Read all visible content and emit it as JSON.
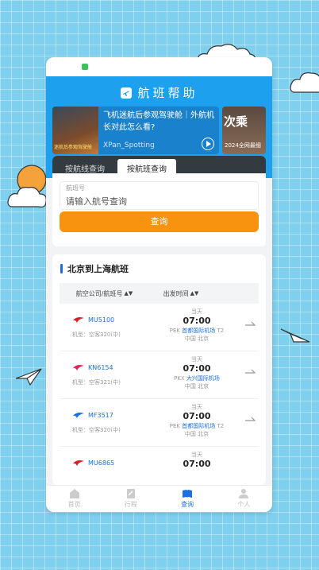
{
  "header": {
    "title": "航班帮助"
  },
  "banner": {
    "headline": "飞机迷航后参观驾驶舱｜外航机长对此怎么看?",
    "thumb_caption": "迷航后参观驾驶舱",
    "source": "XPan_Spotting",
    "side_big": "次乘",
    "side_small": "2024全网最细"
  },
  "search": {
    "tabs": [
      "按航线查询",
      "按航班查询"
    ],
    "field_label": "航班号",
    "field_placeholder": "请输入航号查询",
    "button_label": "查询"
  },
  "list": {
    "title": "北京到上海航班",
    "col_airline": "航空公司/航班号",
    "col_time": "出发时间",
    "rows": [
      {
        "flight": "MU5100",
        "model": "机型：空客320(中)",
        "day": "当天",
        "time": "07:00",
        "code": "PEK",
        "airport": "首都国际机场",
        "terminal": "T2",
        "city": "中国 北京",
        "logo_color": "#d6202a"
      },
      {
        "flight": "KN6154",
        "model": "机型：空客321(中)",
        "day": "当天",
        "time": "07:00",
        "code": "PKX",
        "airport": "大兴国际机场",
        "terminal": "",
        "city": "中国 北京",
        "logo_color": "#e0245e"
      },
      {
        "flight": "MF3517",
        "model": "机型：空客320(中)",
        "day": "当天",
        "time": "07:00",
        "code": "PEK",
        "airport": "首都国际机场",
        "terminal": "T2",
        "city": "中国 北京",
        "logo_color": "#1d6fe0"
      },
      {
        "flight": "MU6865",
        "model": "",
        "day": "当天",
        "time": "07:00",
        "code": "",
        "airport": "",
        "terminal": "",
        "city": "",
        "logo_color": "#d6202a"
      }
    ]
  },
  "nav": {
    "items": [
      "首页",
      "行程",
      "查询",
      "个人"
    ],
    "active": "查询"
  }
}
